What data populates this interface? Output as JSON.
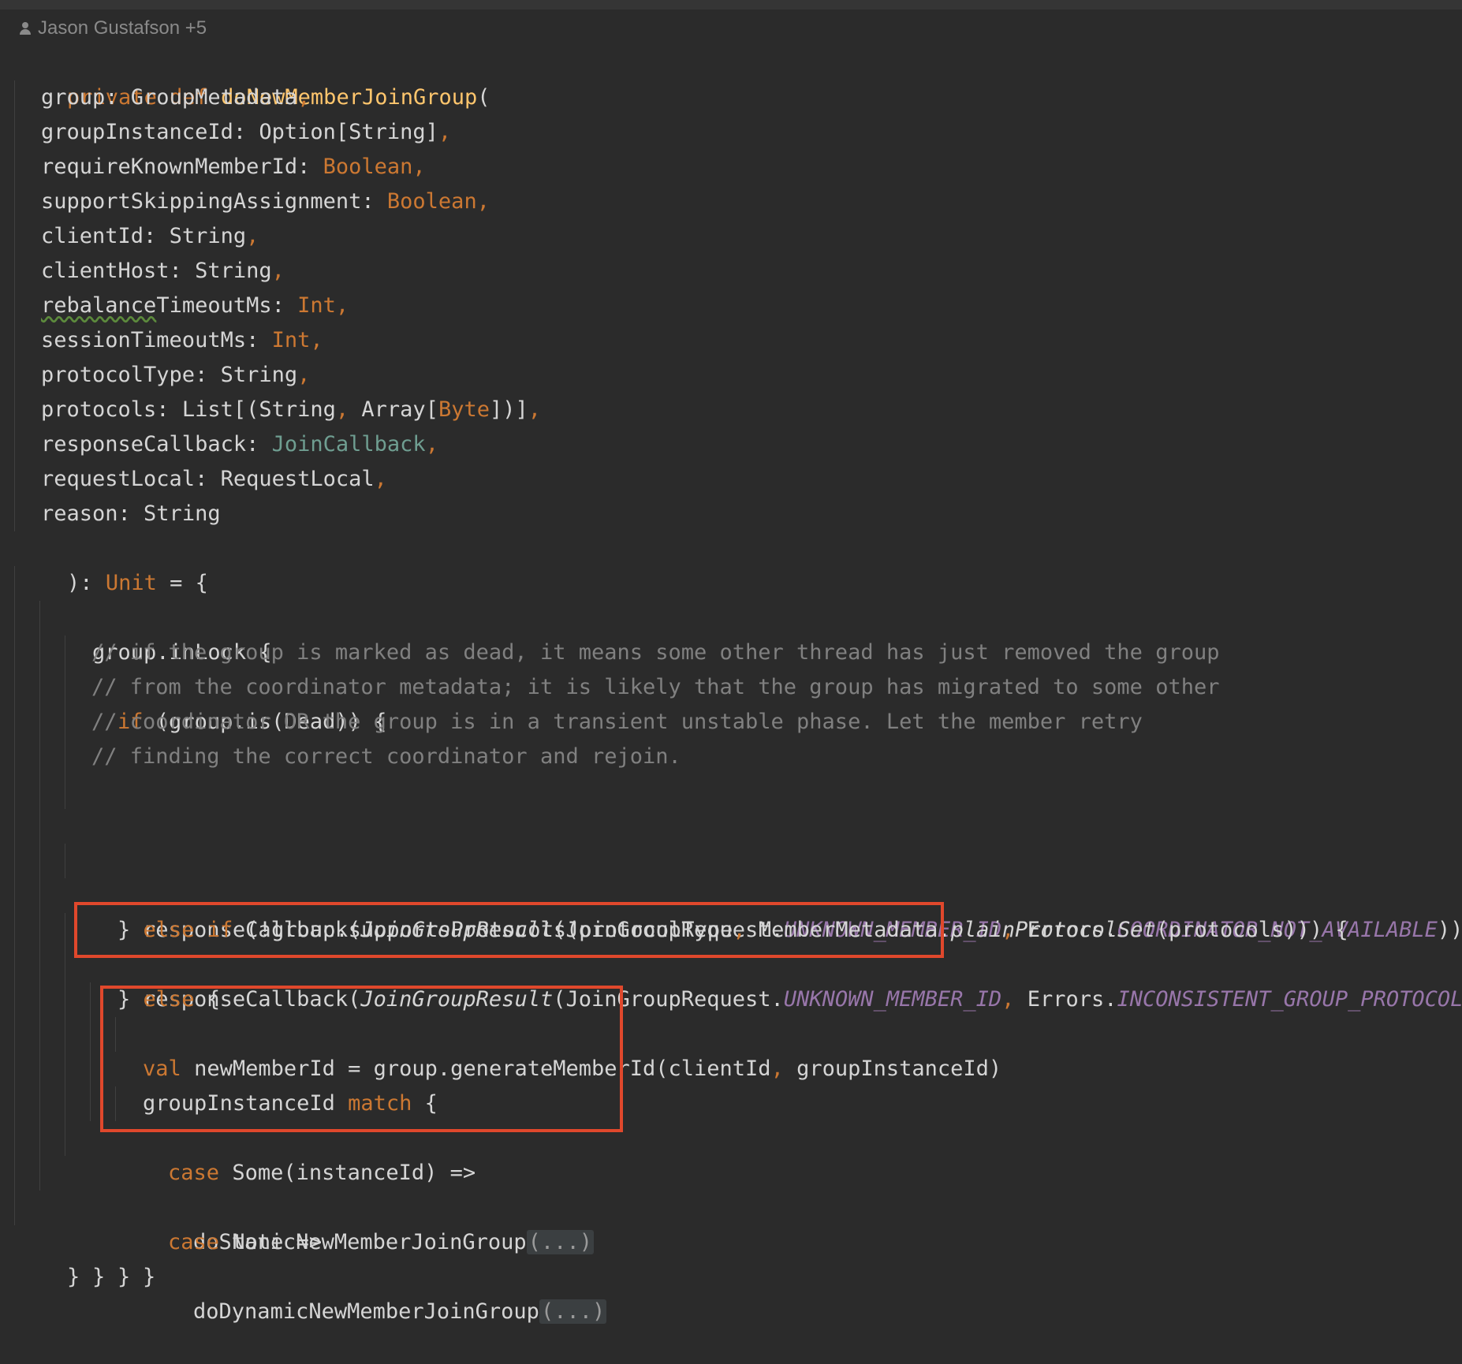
{
  "header": {
    "author": "Jason Gustafson +5"
  },
  "code": {
    "signature": {
      "private": "private",
      "def": "def",
      "name": "doNewMemberJoinGroup",
      "open_paren": "("
    },
    "params": [
      {
        "name": "group: ",
        "type": "GroupMetadata",
        "type_kind": "plain",
        "sep": ","
      },
      {
        "name": "groupInstanceId: ",
        "type": "Option[String]",
        "type_kind": "plain",
        "sep": ","
      },
      {
        "name": "requireKnownMemberId: ",
        "type": "Boolean",
        "type_kind": "keyword",
        "sep": ","
      },
      {
        "name": "supportSkippingAssignment: ",
        "type": "Boolean",
        "type_kind": "keyword",
        "sep": ","
      },
      {
        "name": "clientId: ",
        "type": "String",
        "type_kind": "plain",
        "sep": ","
      },
      {
        "name": "clientHost: ",
        "type": "String",
        "type_kind": "plain",
        "sep": ","
      },
      {
        "name": "rebalanceTimeoutMs: ",
        "type": "Int",
        "type_kind": "keyword",
        "sep": ","
      },
      {
        "name": "sessionTimeoutMs: ",
        "type": "Int",
        "type_kind": "keyword",
        "sep": ","
      },
      {
        "name": "protocolType: ",
        "type": "String",
        "type_kind": "plain",
        "sep": ","
      },
      {
        "name": "protocols: ",
        "type": "List[(String, Array[Byte])]",
        "type_kind": "plain",
        "sep": ","
      },
      {
        "name": "responseCallback: ",
        "type": "JoinCallback",
        "type_kind": "alias",
        "sep": ","
      },
      {
        "name": "requestLocal: ",
        "type": "RequestLocal",
        "type_kind": "plain",
        "sep": ","
      },
      {
        "name": "reason: ",
        "type": "String",
        "type_kind": "plain",
        "sep": ""
      }
    ],
    "return_line": {
      "prefix": "): ",
      "type": "Unit",
      "suffix": " = {"
    },
    "inlock": "group.inLock {",
    "if_line": {
      "kw": "if",
      "rest": " (group.is(Dead)) {"
    },
    "comments": [
      "// if the group is marked as dead, it means some other thread has just removed the group",
      "// from the coordinator metadata; it is likely that the group has migrated to some other",
      "// coordinator OR the group is in a transient unstable phase. Let the member retry",
      "// finding the correct coordinator and rejoin."
    ],
    "callback1": {
      "a": "responseCallback(",
      "b": "JoinGroupResult",
      "c": "(JoinGroupRequest.",
      "d": "UNKNOWN_MEMBER_ID",
      "e": ", ",
      "f": "Errors.",
      "g": "COORDINATOR_NOT_AVAILABLE",
      "h": "))"
    },
    "elseif_line": {
      "close": "} ",
      "kw": "else if",
      "a": " (!group.supportsProtocols(protocolType",
      "comma": ", ",
      "b": "MemberMetadata.",
      "c": "plainProtocolSet",
      "d": "(protocols))) {"
    },
    "callback2": {
      "a": "responseCallback(",
      "b": "JoinGroupResult",
      "c": "(JoinGroupRequest.",
      "d": "UNKNOWN_MEMBER_ID",
      "e": ", ",
      "f": "Errors.",
      "g": "INCONSISTENT_GROUP_PROTOCOL",
      "h": "))"
    },
    "else_line": {
      "close": "} ",
      "kw": "else",
      "open": " {"
    },
    "val_line": {
      "kw": "val",
      "a": " newMemberId = group.generateMemberId(clientId",
      "comma": ", ",
      "b": "groupInstanceId)"
    },
    "match_line": {
      "a": "groupInstanceId ",
      "kw": "match",
      "b": " {"
    },
    "case1": {
      "kw": "case",
      "rest": " Some(instanceId) =>"
    },
    "static_call": {
      "name": "doStaticNewMemberJoinGroup",
      "fold": "(...)"
    },
    "case2": {
      "kw": "case",
      "rest": " None =>"
    },
    "dynamic_call": {
      "name": "doDynamicNewMemberJoinGroup",
      "fold": "(...)"
    },
    "close_brace": "}"
  }
}
